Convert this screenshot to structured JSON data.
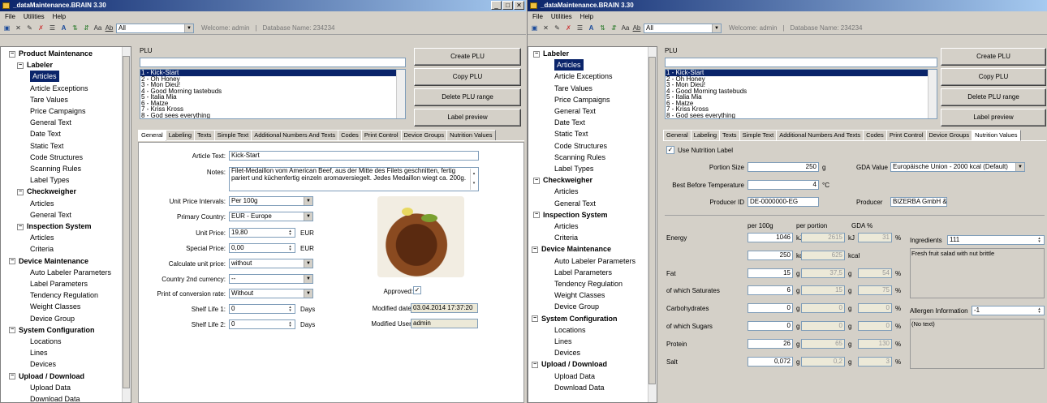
{
  "app": {
    "title": "_dataMaintenance.BRAIN 3.30",
    "menu": [
      "File",
      "Utilities",
      "Help"
    ],
    "filter": "All",
    "welcome": "Welcome: admin",
    "db": "Database Name: 234234",
    "win_buttons": [
      "_",
      "□",
      "✕"
    ]
  },
  "tree_left": [
    {
      "t": "Product Maintenance",
      "b": true,
      "e": "⊟",
      "l": 0
    },
    {
      "t": "Labeler",
      "b": true,
      "e": "⊟",
      "l": 1
    },
    {
      "t": "Articles",
      "sel": true,
      "l": 2
    },
    {
      "t": "Article Exceptions",
      "l": 2
    },
    {
      "t": "Tare Values",
      "l": 2
    },
    {
      "t": "Price Campaigns",
      "l": 2
    },
    {
      "t": "General Text",
      "l": 2
    },
    {
      "t": "Date Text",
      "l": 2
    },
    {
      "t": "Static Text",
      "l": 2
    },
    {
      "t": "Code Structures",
      "l": 2
    },
    {
      "t": "Scanning Rules",
      "l": 2
    },
    {
      "t": "Label Types",
      "l": 2
    },
    {
      "t": "Checkweigher",
      "b": true,
      "e": "⊟",
      "l": 1
    },
    {
      "t": "Articles",
      "l": 2
    },
    {
      "t": "General Text",
      "l": 2
    },
    {
      "t": "Inspection System",
      "b": true,
      "e": "⊟",
      "l": 1
    },
    {
      "t": "Articles",
      "l": 2
    },
    {
      "t": "Criteria",
      "l": 2
    },
    {
      "t": "Device Maintenance",
      "b": true,
      "e": "⊟",
      "l": 0
    },
    {
      "t": "Auto Labeler Parameters",
      "l": 2
    },
    {
      "t": "Label Parameters",
      "l": 2
    },
    {
      "t": "Tendency Regulation",
      "l": 2
    },
    {
      "t": "Weight Classes",
      "l": 2
    },
    {
      "t": "Device Group",
      "l": 2
    },
    {
      "t": "System Configuration",
      "b": true,
      "e": "⊟",
      "l": 0
    },
    {
      "t": "Locations",
      "l": 2
    },
    {
      "t": "Lines",
      "l": 2
    },
    {
      "t": "Devices",
      "l": 2
    },
    {
      "t": "Upload / Download",
      "b": true,
      "e": "⊟",
      "l": 0
    },
    {
      "t": "Upload Data",
      "l": 2
    },
    {
      "t": "Download Data",
      "l": 2
    }
  ],
  "tree_right": [
    {
      "t": "Labeler",
      "b": true,
      "e": "⊟",
      "l": 0
    },
    {
      "t": "Articles",
      "sel": true,
      "l": 2
    },
    {
      "t": "Article Exceptions",
      "l": 2
    },
    {
      "t": "Tare Values",
      "l": 2
    },
    {
      "t": "Price Campaigns",
      "l": 2
    },
    {
      "t": "General Text",
      "l": 2
    },
    {
      "t": "Date Text",
      "l": 2
    },
    {
      "t": "Static Text",
      "l": 2
    },
    {
      "t": "Code Structures",
      "l": 2
    },
    {
      "t": "Scanning Rules",
      "l": 2
    },
    {
      "t": "Label Types",
      "l": 2
    },
    {
      "t": "Checkweigher",
      "b": true,
      "e": "⊟",
      "l": 0
    },
    {
      "t": "Articles",
      "l": 2
    },
    {
      "t": "General Text",
      "l": 2
    },
    {
      "t": "Inspection System",
      "b": true,
      "e": "⊟",
      "l": 0
    },
    {
      "t": "Articles",
      "l": 2
    },
    {
      "t": "Criteria",
      "l": 2
    },
    {
      "t": "Device Maintenance",
      "b": true,
      "e": "⊟",
      "l": -1
    },
    {
      "t": "Auto Labeler Parameters",
      "l": 2
    },
    {
      "t": "Label Parameters",
      "l": 2
    },
    {
      "t": "Tendency Regulation",
      "l": 2
    },
    {
      "t": "Weight Classes",
      "l": 2
    },
    {
      "t": "Device Group",
      "l": 2
    },
    {
      "t": "System Configuration",
      "b": true,
      "e": "⊟",
      "l": -1
    },
    {
      "t": "Locations",
      "l": 2
    },
    {
      "t": "Lines",
      "l": 2
    },
    {
      "t": "Devices",
      "l": 2
    },
    {
      "t": "Upload / Download",
      "b": true,
      "e": "⊟",
      "l": -1
    },
    {
      "t": "Upload Data",
      "l": 2
    },
    {
      "t": "Download Data",
      "l": 2
    }
  ],
  "plu": {
    "label": "PLU",
    "items": [
      "1 - Kick-Start",
      "2 - Oh Honey",
      "3 - Mon Dieu!",
      "4 - Good Morning tastebuds",
      "5 - Italia Mia",
      "6 - Matze",
      "7 - Kriss Kross",
      "8 - God sees everything"
    ]
  },
  "buttons": [
    "Create PLU",
    "Copy PLU",
    "Delete PLU range",
    "Label preview"
  ],
  "tabs": [
    "General",
    "Labeling",
    "Texts",
    "Simple Text",
    "Additional Numbers And Texts",
    "Codes",
    "Print Control",
    "Device Groups",
    "Nutrition Values"
  ],
  "general": {
    "article_text_l": "Article Text:",
    "article_text": "Kick-Start",
    "notes_l": "Notes:",
    "notes": "Filet-Medaillon vom American Beef, aus der Mitte des Filets geschnitten, fertig pariert und küchenfertig einzeln aromaversiegelt. Jedes Medaillon wiegt ca. 200g.",
    "upi_l": "Unit Price Intervals:",
    "upi": "Per 100g",
    "pc_l": "Primary Country:",
    "pc": "EUR - Europe",
    "up_l": "Unit Price:",
    "up": "19,80",
    "up_u": "EUR",
    "sp_l": "Special Price:",
    "sp": "0,00",
    "sp_u": "EUR",
    "cup_l": "Calculate unit price:",
    "cup": "without",
    "c2_l": "Country 2nd currency:",
    "c2": "--",
    "pcr_l": "Print of conversion rate:",
    "pcr": "Without",
    "sl1_l": "Shelf Life 1:",
    "sl1": "0",
    "sl1_u": "Days",
    "sl2_l": "Shelf Life 2:",
    "sl2": "0",
    "sl2_u": "Days",
    "appr_l": "Approved:",
    "md_l": "Modified date:",
    "md": "03.04.2014 17:37:20",
    "mu_l": "Modified User:",
    "mu": "admin"
  },
  "nutrition": {
    "use_l": "Use Nutrition Label",
    "ps_l": "Portion Size",
    "ps": "250",
    "ps_u": "g",
    "gda_l": "GDA Value",
    "gda": "Europäische Union - 2000 kcal (Default)",
    "bbt_l": "Best Before Temperature",
    "bbt": "4",
    "bbt_u": "°C",
    "pid_l": "Producer ID",
    "pid": "DE-0000000-EG",
    "prod_l": "Producer",
    "prod": "BIZERBA GmbH &",
    "h100": "per 100g",
    "hpp": "per portion",
    "hgda": "GDA %",
    "rows": [
      {
        "n": "Energy",
        "v": "1046",
        "u": "kJ",
        "p": "2615",
        "pu": "kJ",
        "g": "31",
        "gu": "%"
      },
      {
        "n": "",
        "v": "250",
        "u": "kcal",
        "p": "625",
        "pu": "kcal",
        "g": "",
        "gu": ""
      },
      {
        "n": "Fat",
        "v": "15",
        "u": "g",
        "p": "37,5",
        "pu": "g",
        "g": "54",
        "gu": "%"
      },
      {
        "n": "of which Saturates",
        "v": "6",
        "u": "g",
        "p": "15",
        "pu": "g",
        "g": "75",
        "gu": "%"
      },
      {
        "n": "Carbohydrates",
        "v": "0",
        "u": "g",
        "p": "0",
        "pu": "g",
        "g": "0",
        "gu": "%"
      },
      {
        "n": "of which Sugars",
        "v": "0",
        "u": "g",
        "p": "0",
        "pu": "g",
        "g": "0",
        "gu": "%"
      },
      {
        "n": "Protein",
        "v": "26",
        "u": "g",
        "p": "65",
        "pu": "g",
        "g": "130",
        "gu": "%"
      },
      {
        "n": "Salt",
        "v": "0,072",
        "u": "g",
        "p": "0,2",
        "pu": "g",
        "g": "3",
        "gu": "%"
      }
    ],
    "ing_l": "Ingredients",
    "ing": "111",
    "ing_t": "Fresh fruit salad with nut brittle",
    "all_l": "Allergen Information",
    "all": "-1",
    "all_t": "(No text)"
  }
}
